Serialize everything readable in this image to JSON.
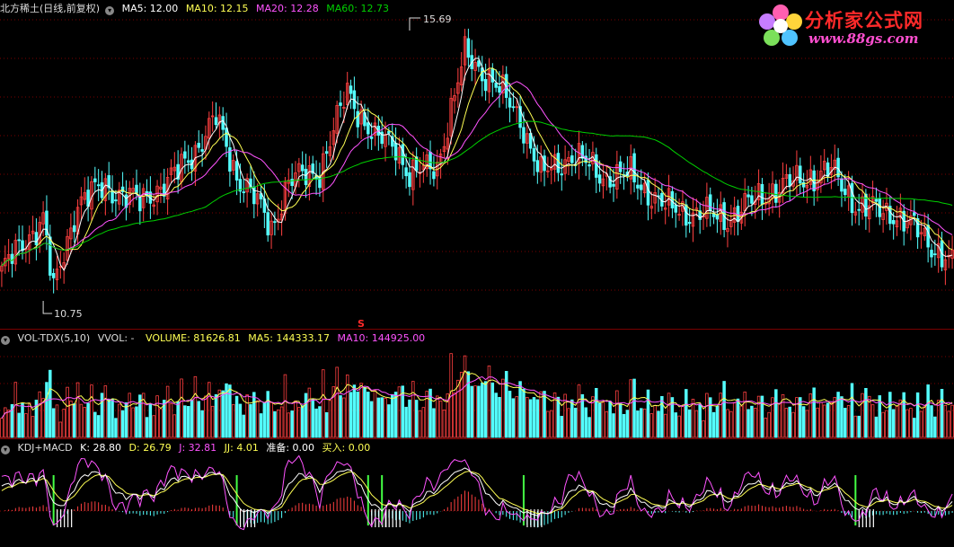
{
  "price_panel": {
    "stock_name": "北方稀土(日线,前复权)",
    "ma5_label": "MA5: 12.00",
    "ma10_label": "MA10: 12.15",
    "ma20_label": "MA20: 12.28",
    "ma60_label": "MA60: 12.73",
    "high_marker": "15.69",
    "low_marker": "10.75",
    "signal_marker": "S"
  },
  "volume_panel": {
    "indicator": "VOL-TDX(5,10)",
    "vvol": "VVOL: -",
    "volume": "VOLUME: 81626.81",
    "ma5": "MA5: 144333.17",
    "ma10": "MA10: 144925.00"
  },
  "kdj_panel": {
    "indicator": "KDJ+MACD",
    "k": "K: 28.80",
    "d": "D: 26.79",
    "j": "J: 32.81",
    "jj": "JJ: 4.01",
    "prep": "准备: 0.00",
    "buy": "买入: 0.00"
  },
  "logo": {
    "title": "分析家公式网",
    "url": "www.88gs.com"
  },
  "colors": {
    "up": "#ff4040",
    "down": "#54ffff",
    "ma5": "#ffffff",
    "ma10": "#ffff54",
    "ma20": "#ff54ff",
    "ma60": "#00d000",
    "buy_signal": "#44ff44",
    "grid": "#7a0000"
  },
  "chart_data": {
    "type": "candlestick",
    "title": "北方稀土(日线,前复权)",
    "price_range": [
      10.75,
      15.69
    ],
    "annotated_high": 15.69,
    "annotated_low": 10.75,
    "moving_averages_last": {
      "MA5": 12.0,
      "MA10": 12.15,
      "MA20": 12.28,
      "MA60": 12.73
    },
    "volume_last": {
      "VOLUME": 81626.81,
      "MA5": 144333.17,
      "MA10": 144925.0
    },
    "kdj_last": {
      "K": 28.8,
      "D": 26.79,
      "J": 32.81,
      "JJ": 4.01,
      "准备": 0.0,
      "买入": 0.0
    }
  }
}
